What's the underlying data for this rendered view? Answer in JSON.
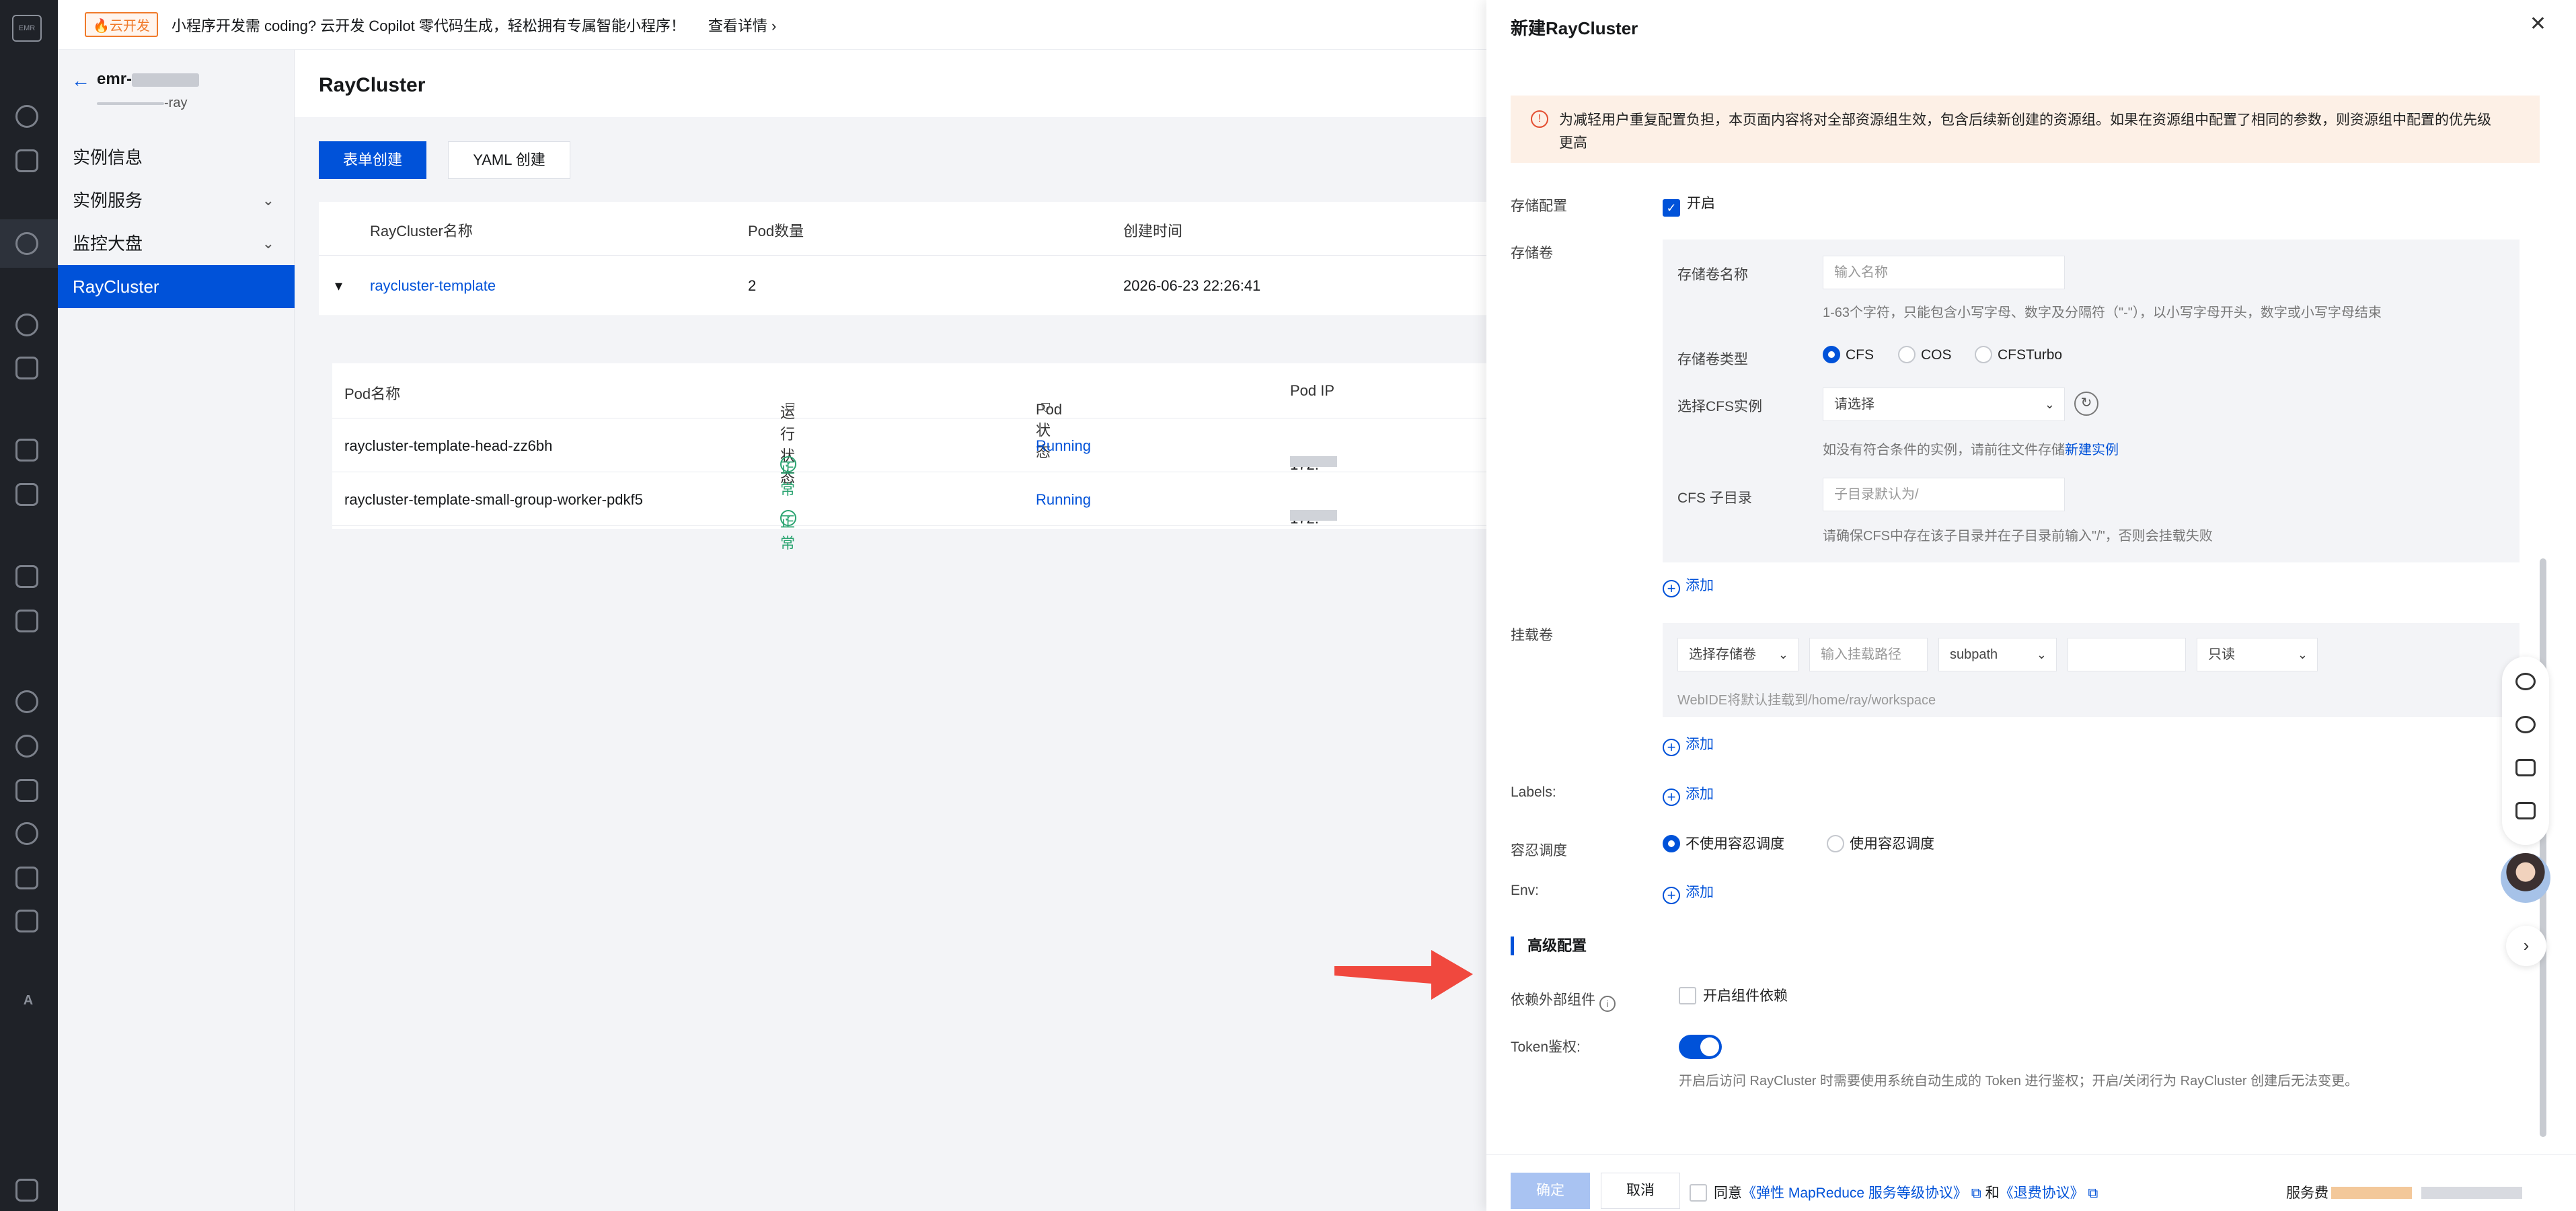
{
  "rail": {
    "logo": "EMR",
    "bottom_label": "A"
  },
  "banner": {
    "tag": "🔥云开发",
    "message": "小程序开发需 coding? 云开发 Copilot 零代码生成，轻松拥有专属智能小程序！",
    "link": "查看详情 ›"
  },
  "sidebar": {
    "back": "←",
    "instance_name": "emr-",
    "instance_sub": "-ray",
    "items": [
      {
        "label": "实例信息",
        "chevron": ""
      },
      {
        "label": "实例服务",
        "chevron": "⌄"
      },
      {
        "label": "监控大盘",
        "chevron": "⌄"
      },
      {
        "label": "RayCluster",
        "chevron": ""
      }
    ]
  },
  "main": {
    "title": "RayCluster",
    "create_form_btn": "表单创建",
    "create_yaml_btn": "YAML 创建",
    "table": {
      "headers": [
        "RayCluster名称",
        "Pod数量",
        "创建时间"
      ],
      "row": {
        "expander": "▾",
        "name": "raycluster-template",
        "pods": "2",
        "created": "2026-06-23 22:26:41"
      }
    },
    "pod_table": {
      "headers": [
        "Pod名称",
        "运行状态",
        "Pod状态",
        "Pod IP"
      ],
      "filter_icon": "⛉",
      "rows": [
        {
          "name": "raycluster-template-head-zz6bh",
          "run": "正常",
          "status": "Running",
          "ip": "172."
        },
        {
          "name": "raycluster-template-small-group-worker-pdkf5",
          "run": "正常",
          "status": "Running",
          "ip": "172."
        }
      ]
    }
  },
  "drawer": {
    "title": "新建RayCluster",
    "close": "✕",
    "alert": "为减轻用户重复配置负担，本页面内容将对全部资源组生效，包含后续新创建的资源组。如果在资源组中配置了相同的参数，则资源组中配置的优先级更高",
    "alert_icon": "!",
    "storage_cfg": {
      "label": "存储配置",
      "value": "开启"
    },
    "storage": {
      "label": "存储卷",
      "name_label": "存储卷名称",
      "name_placeholder": "输入名称",
      "name_hint": "1-63个字符，只能包含小写字母、数字及分隔符（\"-\"），以小写字母开头，数字或小写字母结束",
      "type_label": "存储卷类型",
      "types": [
        "CFS",
        "COS",
        "CFSTurbo"
      ],
      "cfs_label": "选择CFS实例",
      "cfs_placeholder": "请选择",
      "cfs_hint": "如没有符合条件的实例，请前往文件存储",
      "cfs_hint_link": "新建实例",
      "subdir_label": "CFS 子目录",
      "subdir_placeholder": "子目录默认为/",
      "subdir_hint": "请确保CFS中存在该子目录并在子目录前输入\"/\"，否则会挂载失败",
      "add": "添加"
    },
    "mount": {
      "label": "挂载卷",
      "select_volume": "选择存储卷",
      "path_placeholder": "输入挂载路径",
      "subpath": "subpath",
      "mode": "只读",
      "hint": "WebIDE将默认挂载到/home/ray/workspace",
      "add": "添加"
    },
    "labels": {
      "label": "Labels:",
      "add": "添加"
    },
    "toleration": {
      "label": "容忍调度",
      "options": [
        "不使用容忍调度",
        "使用容忍调度"
      ]
    },
    "env": {
      "label": "Env:",
      "add": "添加"
    },
    "advanced": {
      "title": "高级配置",
      "dep_label": "依赖外部组件",
      "dep_checkbox": "开启组件依赖",
      "token_label": "Token鉴权:",
      "token_hint": "开启后访问 RayCluster 时需要使用系统自动生成的 Token 进行鉴权；开启/关闭行为 RayCluster 创建后无法变更。"
    },
    "footer": {
      "confirm": "确定",
      "cancel": "取消",
      "agree_prefix": "同意",
      "agree_link1": "《弹性 MapReduce 服务等级协议》",
      "agree_and": "和",
      "agree_link2": "《退费协议》",
      "fee_label": "服务费"
    }
  },
  "colors": {
    "primary": "#0052d9",
    "success": "#2ba471",
    "warn_bg": "#fdf0e6",
    "annotation_arrow": "#f0483e"
  }
}
